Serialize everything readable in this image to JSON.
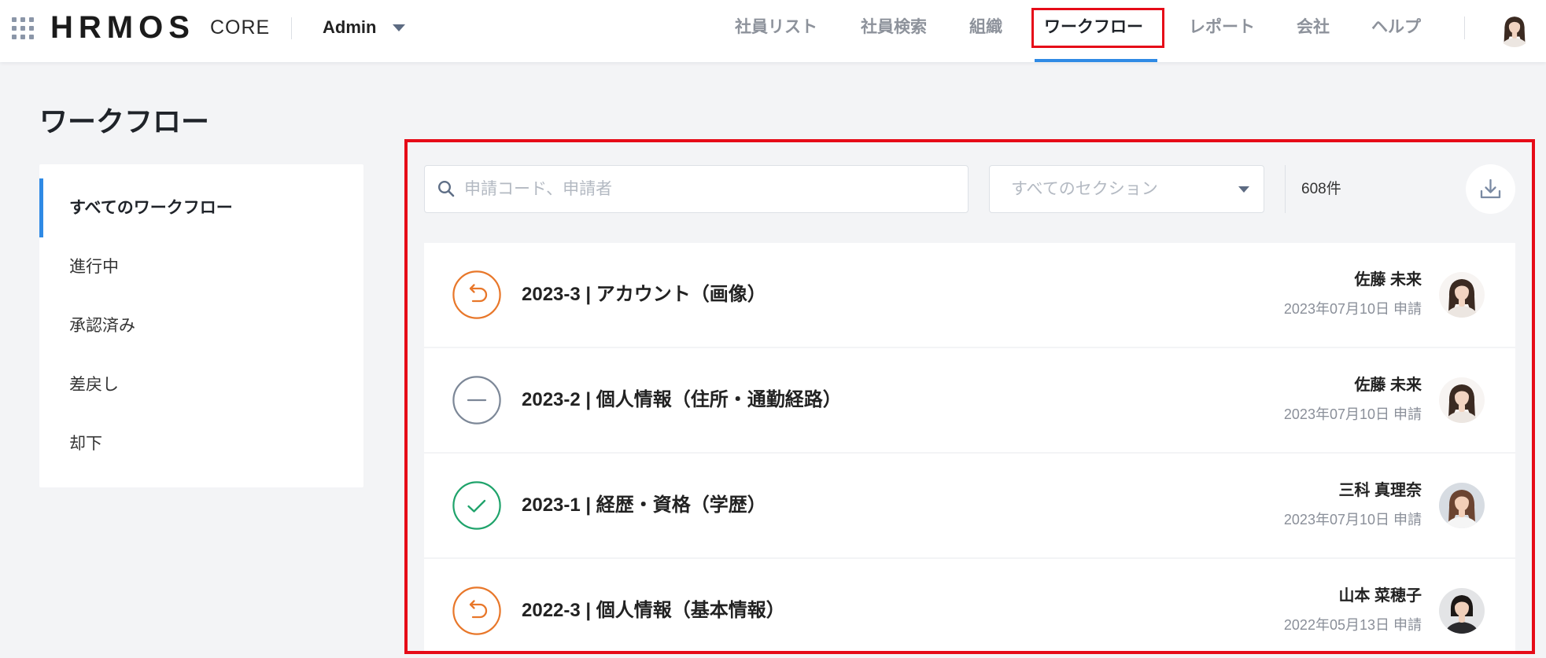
{
  "header": {
    "logo": "HRMOS",
    "product": "CORE",
    "account": "Admin",
    "nav": [
      {
        "label": "社員リスト",
        "active": false
      },
      {
        "label": "社員検索",
        "active": false
      },
      {
        "label": "組織",
        "active": false
      },
      {
        "label": "ワークフロー",
        "active": true
      },
      {
        "label": "レポート",
        "active": false
      },
      {
        "label": "会社",
        "active": false
      },
      {
        "label": "ヘルプ",
        "active": false
      }
    ],
    "icons": {
      "app_switcher": "grid-icon",
      "account_menu": "chevron-down-icon",
      "user": "avatar"
    }
  },
  "page": {
    "title": "ワークフロー"
  },
  "sidebar": {
    "items": [
      {
        "label": "すべてのワークフロー",
        "active": true
      },
      {
        "label": "進行中",
        "active": false
      },
      {
        "label": "承認済み",
        "active": false
      },
      {
        "label": "差戻し",
        "active": false
      },
      {
        "label": "却下",
        "active": false
      }
    ]
  },
  "toolbar": {
    "search": {
      "placeholder": "申請コード、申請者",
      "icon": "search-icon"
    },
    "section_filter": {
      "placeholder": "すべてのセクション",
      "icon": "caret-down-icon"
    },
    "count": "608件",
    "download_icon": "download-icon"
  },
  "workflows": [
    {
      "title": "2023-3 | アカウント（画像）",
      "status_icon": "undo-icon",
      "status_color": "#e8772a",
      "applicant": "佐藤 未来",
      "applied": "2023年07月10日 申請"
    },
    {
      "title": "2023-2 | 個人情報（住所・通勤経路）",
      "status_icon": "minus-icon",
      "status_color": "#7c8797",
      "applicant": "佐藤 未来",
      "applied": "2023年07月10日 申請"
    },
    {
      "title": "2023-1 | 経歴・資格（学歴）",
      "status_icon": "check-icon",
      "status_color": "#1fa36b",
      "applicant": "三科 真理奈",
      "applied": "2023年07月10日 申請"
    },
    {
      "title": "2022-3 | 個人情報（基本情報）",
      "status_icon": "undo-icon",
      "status_color": "#e8772a",
      "applicant": "山本 菜穂子",
      "applied": "2022年05月13日 申請"
    }
  ],
  "colors": {
    "accent": "#2f8ae5",
    "highlight_box": "#e60b18",
    "page_bg": "#f3f4f6"
  }
}
